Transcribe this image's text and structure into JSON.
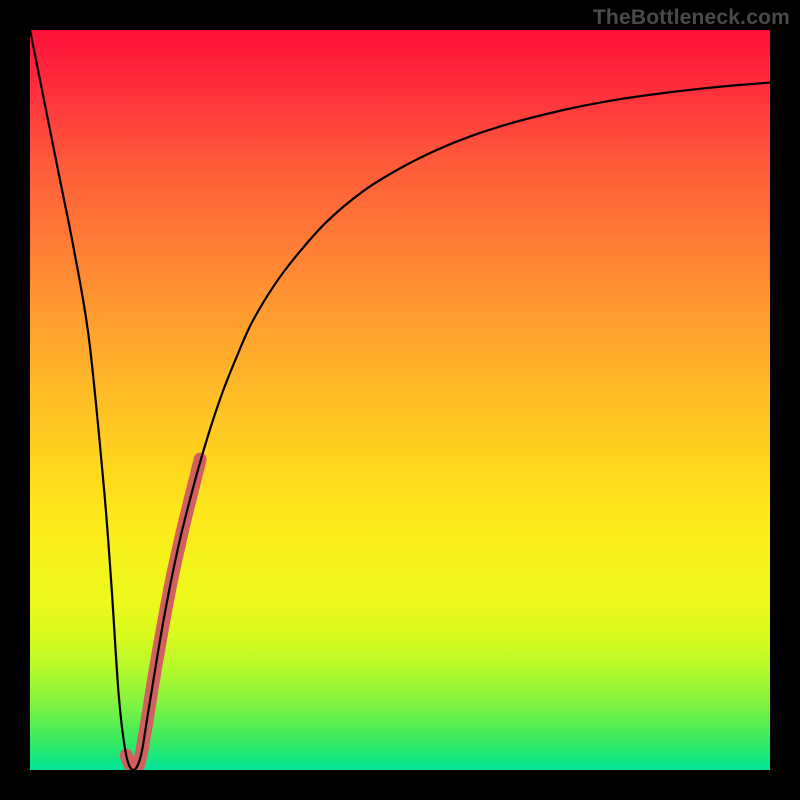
{
  "watermark": {
    "text": "TheBottleneck.com"
  },
  "chart_data": {
    "type": "line",
    "title": "",
    "xlabel": "",
    "ylabel": "",
    "xlim": [
      0,
      100
    ],
    "ylim": [
      0,
      100
    ],
    "grid": false,
    "legend": false,
    "series": [
      {
        "name": "bottleneck-curve",
        "color": "#000000",
        "stroke_width": 2.2,
        "x": [
          0,
          2,
          4,
          6,
          8,
          10,
          11,
          12,
          13,
          14,
          15,
          16,
          18,
          20,
          22,
          24,
          26,
          28,
          30,
          33,
          36,
          40,
          45,
          50,
          55,
          60,
          65,
          70,
          75,
          80,
          85,
          90,
          95,
          100
        ],
        "values": [
          100,
          90,
          80,
          70,
          58,
          38,
          25,
          10,
          2,
          0,
          2,
          8,
          20,
          30,
          38,
          45,
          51,
          56,
          60.5,
          65.5,
          69.5,
          74,
          78.2,
          81.3,
          83.8,
          85.8,
          87.4,
          88.7,
          89.8,
          90.7,
          91.4,
          92,
          92.5,
          92.9
        ]
      },
      {
        "name": "highlight-segment",
        "color": "#d1605e",
        "stroke_width": 13,
        "linecap": "round",
        "x": [
          13,
          14,
          15,
          17,
          19,
          21,
          23
        ],
        "values": [
          2,
          0,
          2,
          14,
          25,
          34,
          42
        ]
      }
    ]
  }
}
